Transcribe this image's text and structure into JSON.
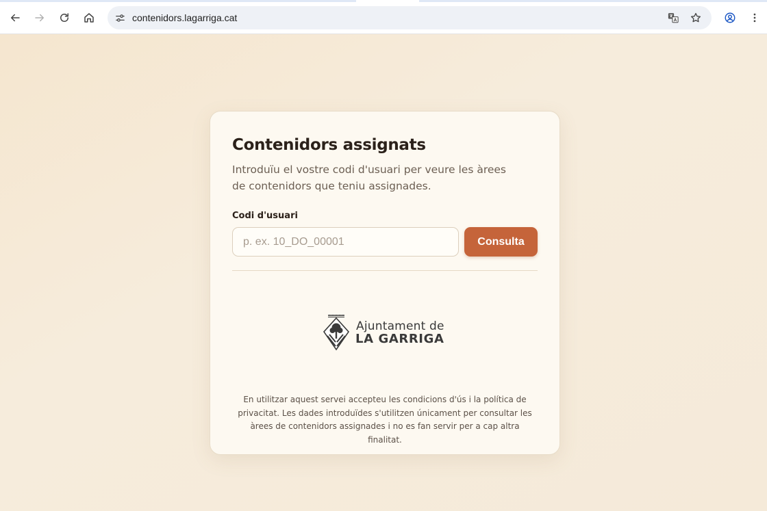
{
  "browser": {
    "url": "contenidors.lagarriga.cat",
    "icons": {
      "back": "arrow-left-icon",
      "forward": "arrow-right-icon",
      "reload": "reload-icon",
      "home": "home-icon",
      "site_info": "tune-icon",
      "translate": "translate-icon",
      "bookmark": "star-icon",
      "profile": "account-circle-icon",
      "menu": "kebab-menu-icon"
    }
  },
  "card": {
    "title": "Contenidors assignats",
    "subtitle": "Introduïu el vostre codi d'usuari per veure les àrees de contenidors que teniu assignades.",
    "field_label": "Codi d'usuari",
    "input_value": "",
    "input_placeholder": "p. ex. 10_DO_00001",
    "button_label": "Consulta",
    "logo": {
      "line1": "Ajuntament de",
      "line2": "LA GARRIGA"
    },
    "legal_text": "En utilitzar aquest servei accepteu les condicions d'ús i la política de privacitat. Les dades introduïdes s'utilitzen únicament per consultar les àrees de contenidors assignades i no es fan servir per a cap altra finalitat."
  },
  "colors": {
    "accent": "#c5643a",
    "page_background": "#f4ead9",
    "card_background": "#fdf9f1",
    "title_text": "#2b211a"
  }
}
